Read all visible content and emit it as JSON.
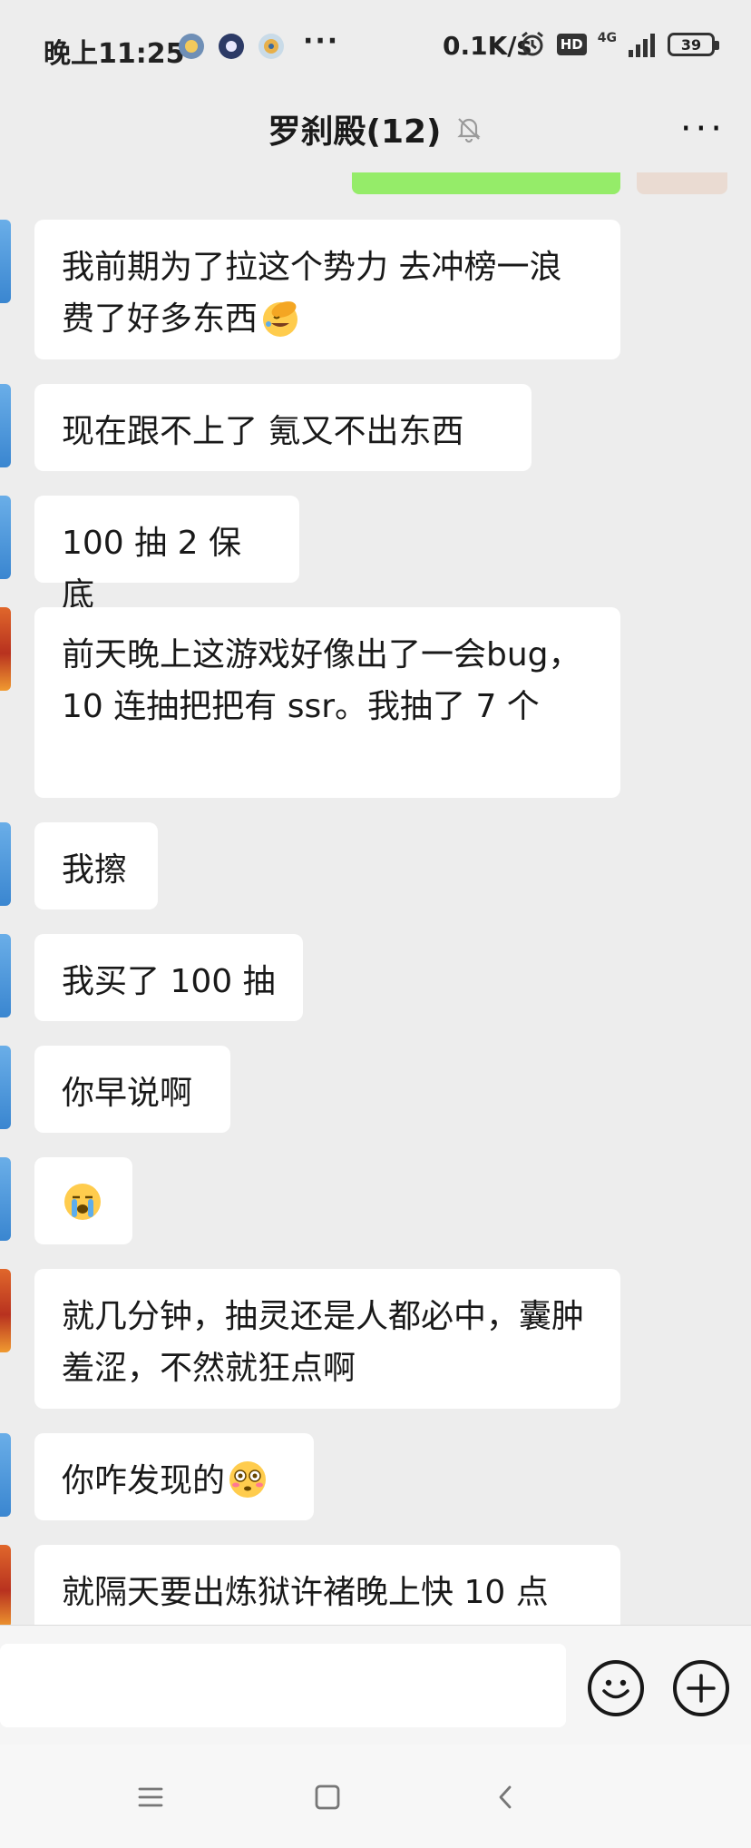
{
  "status_bar": {
    "time": "晚上11:25",
    "more": "···",
    "net_speed": "0.1K/s",
    "hd_label": "HD",
    "network": "4G",
    "battery": "39",
    "icons": [
      "app-notification-icon-1",
      "app-notification-icon-2",
      "app-notification-icon-3",
      "alarm-icon",
      "hd-icon",
      "signal-icon",
      "battery-icon"
    ]
  },
  "header": {
    "title": "罗刹殿(12)",
    "muted_icon": "bell-off-icon",
    "more_label": "···"
  },
  "messages": [
    {
      "sender": "blue",
      "text": "我前期为了拉这个势力 去冲榜一浪费了好多东西",
      "emoji": "facepalm"
    },
    {
      "sender": "blue",
      "text": "现在跟不上了 氪又不出东西",
      "emoji": ""
    },
    {
      "sender": "blue",
      "text": "100 抽 2 保底",
      "emoji": ""
    },
    {
      "sender": "red",
      "text": "前天晚上这游戏好像出了一会bug，10 连抽把把有 ssr。我抽了 7 个",
      "emoji": ""
    },
    {
      "sender": "blue",
      "text": "我擦",
      "emoji": ""
    },
    {
      "sender": "blue",
      "text": "我买了 100 抽",
      "emoji": ""
    },
    {
      "sender": "blue",
      "text": "你早说啊",
      "emoji": ""
    },
    {
      "sender": "blue",
      "text": "",
      "emoji": "crying"
    },
    {
      "sender": "red",
      "text": "就几分钟，抽灵还是人都必中，囊肿羞涩，不然就狂点啊",
      "emoji": ""
    },
    {
      "sender": "blue",
      "text": "你咋发现的",
      "emoji": "flushed"
    },
    {
      "sender": "red",
      "text": "就隔天要出炼狱许褚晚上快 10 点",
      "emoji": ""
    }
  ],
  "input_bar": {
    "placeholder": "",
    "emoji_button": "smiley-face-icon",
    "more_button": "plus-icon"
  },
  "nav_bar": {
    "icons": [
      "menu-icon",
      "home-square-icon",
      "back-chevron-icon"
    ]
  },
  "colors": {
    "background": "#ededed",
    "bubble": "#ffffff",
    "own_bubble": "#95ec69",
    "text": "#191919"
  }
}
